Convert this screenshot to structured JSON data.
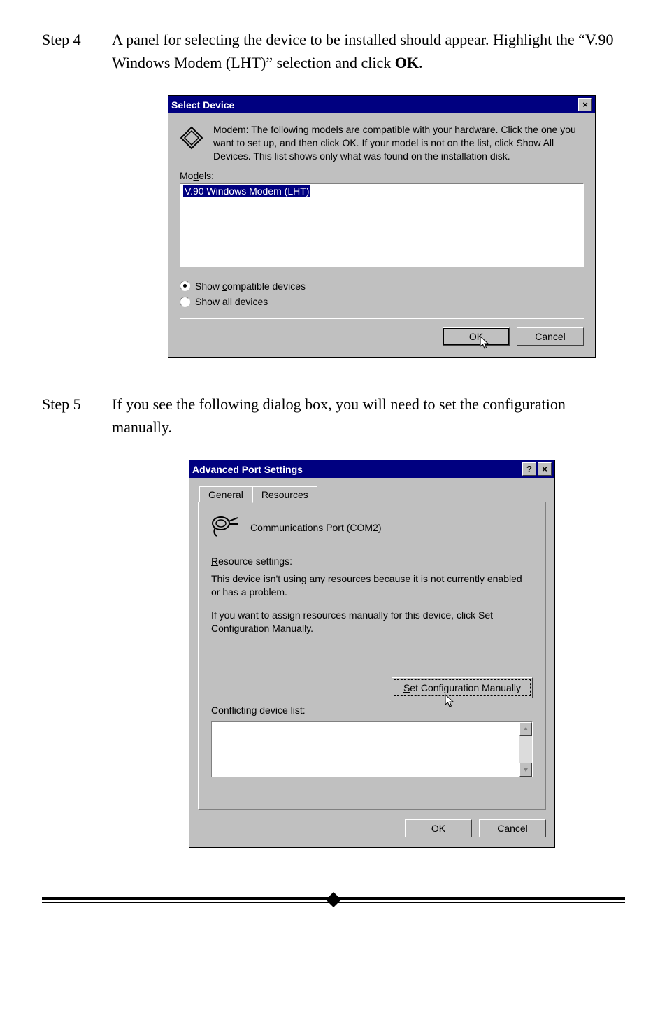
{
  "step4": {
    "label": "Step 4",
    "text_before": "A panel for selecting the device to be installed should appear. Highlight the “V.90 Windows Modem (LHT)” selection and click ",
    "bold": "OK",
    "text_after": "."
  },
  "step5": {
    "label": "Step 5",
    "text": "If you see the following dialog box, you will need to set the configuration manually."
  },
  "select_device": {
    "title": "Select Device",
    "close_label": "×",
    "description": "Modem: The following models are compatible with your hardware. Click the one you want to set up, and then click OK. If your model is not on the list, click Show All Devices. This list shows only what was found on the installation disk.",
    "models_label_html": "Mo<u>d</u>els:",
    "list_item": "V.90 Windows Modem (LHT)",
    "radio_compatible_html": "Show <u>c</u>ompatible devices",
    "radio_all_html": "Show <u>a</u>ll devices",
    "ok": "OK",
    "cancel": "Cancel"
  },
  "advanced_port": {
    "title": "Advanced Port Settings",
    "help_label": "?",
    "close_label": "×",
    "tab_general": "General",
    "tab_resources": "Resources",
    "port_name": "Communications Port (COM2)",
    "resource_settings_html": "<u>R</u>esource settings:",
    "para1": "This device isn't using any resources because it is not currently enabled or has a problem.",
    "para2": "If you want to assign resources manually for this device, click Set Configuration Manually.",
    "set_config_btn_html": "<u>S</u>et Configuration Manually",
    "conflict_label": "Conflicting device list:",
    "ok": "OK",
    "cancel": "Cancel"
  }
}
